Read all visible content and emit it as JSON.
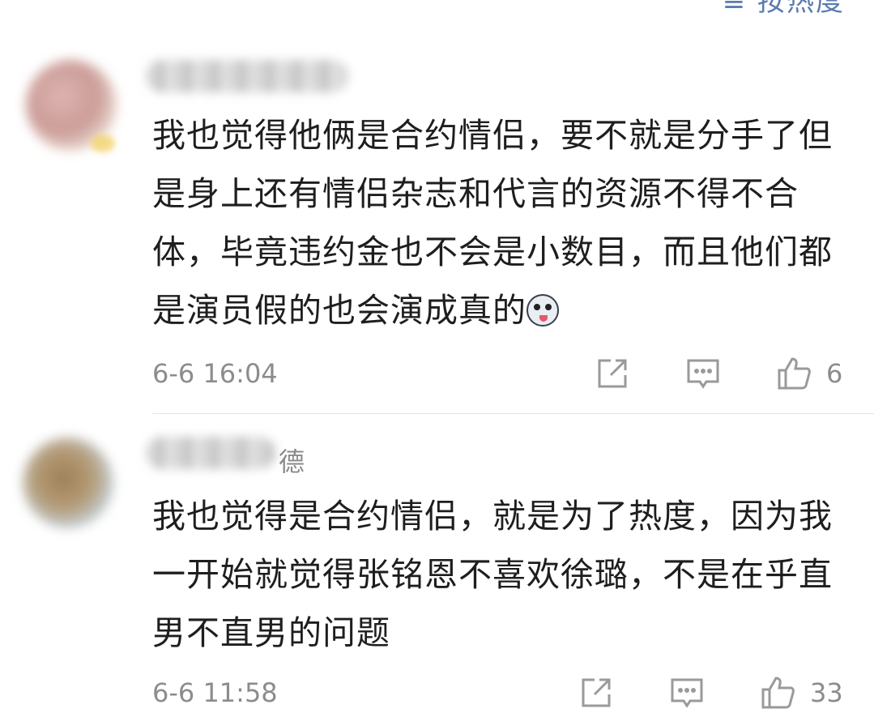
{
  "header": {
    "sort_label": "≡ 按热度"
  },
  "comments": [
    {
      "username_suffix": "",
      "text": "我也觉得他俩是合约情侣，要不就是分手了但是身上还有情侣杂志和代言的资源不得不合体，毕竟违约金也不会是小数目，而且他们都是演员假的也会演成真的",
      "emoji": "husky-emoji",
      "time": "6-6 16:04",
      "likes": "6"
    },
    {
      "username_suffix": "德",
      "text": "我也觉得是合约情侣，就是为了热度，因为我一开始就觉得张铭恩不喜欢徐璐，不是在乎直男不直男的问题",
      "time": "6-6 11:58",
      "likes": "33"
    }
  ],
  "icons": {
    "share": "share-icon",
    "reply": "comment-icon",
    "like": "thumbs-up-icon"
  },
  "colors": {
    "meta_gray": "#8c8c8c",
    "link_blue": "#5b7bb0",
    "icon_gray": "#9a9a9a"
  }
}
